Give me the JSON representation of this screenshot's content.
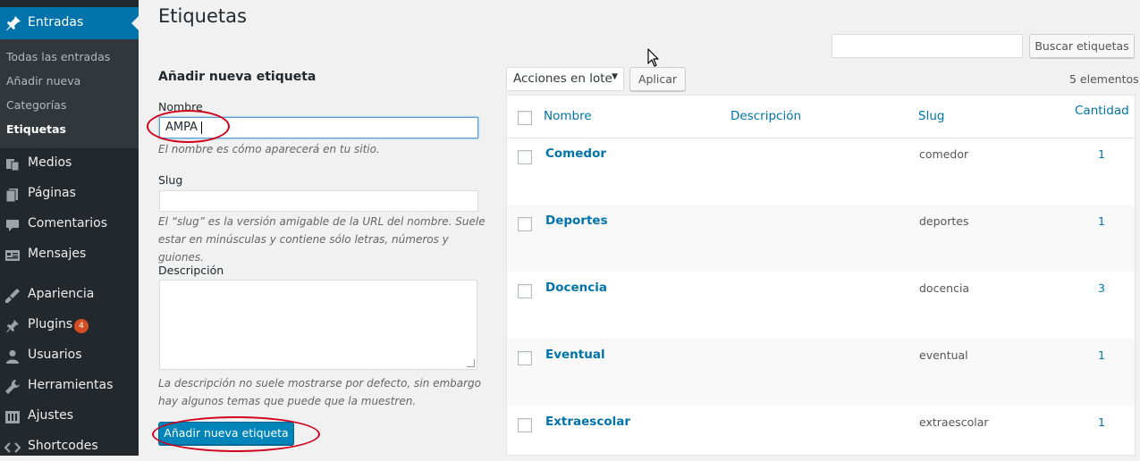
{
  "sidebar": {
    "active": {
      "label": "Entradas",
      "icon": "pushpin-icon"
    },
    "submenu": [
      {
        "label": "Todas las entradas"
      },
      {
        "label": "Añadir nueva"
      },
      {
        "label": "Categorías"
      },
      {
        "label": "Etiquetas",
        "current": true
      }
    ],
    "items": [
      {
        "label": "Medios",
        "icon": "media-icon"
      },
      {
        "label": "Páginas",
        "icon": "pages-icon"
      },
      {
        "label": "Comentarios",
        "icon": "comments-icon"
      },
      {
        "label": "Mensajes",
        "icon": "messages-icon"
      },
      {
        "label": "Apariencia",
        "icon": "appearance-icon"
      },
      {
        "label": "Plugins",
        "icon": "plugins-icon",
        "badge": "4"
      },
      {
        "label": "Usuarios",
        "icon": "users-icon"
      },
      {
        "label": "Herramientas",
        "icon": "tools-icon"
      },
      {
        "label": "Ajustes",
        "icon": "settings-icon"
      },
      {
        "label": "Shortcodes",
        "icon": "code-icon"
      }
    ]
  },
  "page": {
    "title": "Etiquetas"
  },
  "search": {
    "value": "",
    "button_label": "Buscar etiquetas"
  },
  "form": {
    "title": "Añadir nueva etiqueta",
    "name_label": "Nombre",
    "name_value": "AMPA",
    "name_hint": "El nombre es cómo aparecerá en tu sitio.",
    "slug_label": "Slug",
    "slug_value": "",
    "slug_hint": "El “slug” es la versión amigable de la URL del nombre. Suele estar en minúsculas y contiene sólo letras, números y guiones.",
    "description_label": "Descripción",
    "description_value": "",
    "description_hint": "La descripción no suele mostrarse por defecto, sin embargo hay algunos temas que puede que la muestren.",
    "submit_label": "Añadir nueva etiqueta"
  },
  "bulk": {
    "selected": "Acciones en lote",
    "apply_label": "Aplicar",
    "count_text": "5 elementos"
  },
  "table": {
    "columns": {
      "name": "Nombre",
      "description": "Descripción",
      "slug": "Slug",
      "count": "Cantidad"
    },
    "rows": [
      {
        "name": "Comedor",
        "slug": "comedor",
        "count": "1"
      },
      {
        "name": "Deportes",
        "slug": "deportes",
        "count": "1"
      },
      {
        "name": "Docencia",
        "slug": "docencia",
        "count": "3"
      },
      {
        "name": "Eventual",
        "slug": "eventual",
        "count": "1"
      },
      {
        "name": "Extraescolar",
        "slug": "extraescolar",
        "count": "1"
      }
    ]
  },
  "colors": {
    "sidebar": "#23282d",
    "accent": "#0073aa",
    "annotation": "#d0011b",
    "primary_button": "#0085ba"
  }
}
